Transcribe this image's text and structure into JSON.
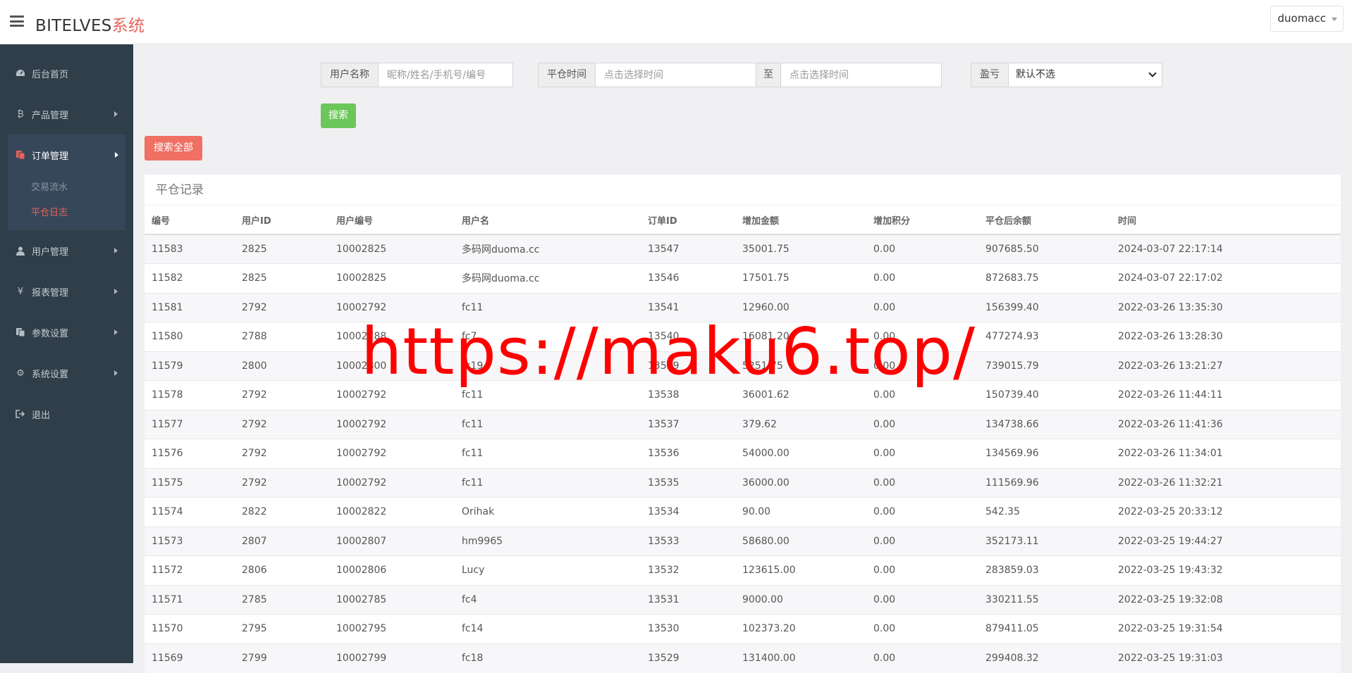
{
  "header": {
    "brand_main": "BITELVES",
    "brand_accent": "系统",
    "user": "duomacc"
  },
  "sidebar": {
    "items": [
      {
        "label": "后台首页",
        "icon": "dashboard-icon"
      },
      {
        "label": "产品管理",
        "icon": "bitcoin-icon"
      },
      {
        "label": "订单管理",
        "icon": "copy-icon"
      },
      {
        "label": "用户管理",
        "icon": "user-icon"
      },
      {
        "label": "报表管理",
        "icon": "yen-icon"
      },
      {
        "label": "参数设置",
        "icon": "copy-icon"
      },
      {
        "label": "系统设置",
        "icon": "gears-icon"
      },
      {
        "label": "退出",
        "icon": "sign-out-icon"
      }
    ],
    "sub_items": [
      {
        "label": "交易流水"
      },
      {
        "label": "平仓日志"
      }
    ]
  },
  "filters": {
    "username_label": "用户名称",
    "username_placeholder": "昵称/姓名/手机号/编号",
    "time_label": "平仓时间",
    "time_start_placeholder": "点击选择时间",
    "time_sep": "至",
    "time_end_placeholder": "点击选择时间",
    "pnl_label": "盈亏",
    "pnl_selected": "默认不选",
    "search_button": "搜索",
    "search_all_button": "搜索全部"
  },
  "table": {
    "title": "平仓记录",
    "columns": [
      "编号",
      "用户ID",
      "用户编号",
      "用户名",
      "订单ID",
      "增加金额",
      "增加积分",
      "平仓后余额",
      "时间"
    ],
    "rows": [
      [
        "11583",
        "2825",
        "10002825",
        "多码网duoma.cc",
        "13547",
        "35001.75",
        "0.00",
        "907685.50",
        "2024-03-07 22:17:14"
      ],
      [
        "11582",
        "2825",
        "10002825",
        "多码网duoma.cc",
        "13546",
        "17501.75",
        "0.00",
        "872683.75",
        "2024-03-07 22:17:02"
      ],
      [
        "11581",
        "2792",
        "10002792",
        "fc11",
        "13541",
        "12960.00",
        "0.00",
        "156399.40",
        "2022-03-26 13:35:30"
      ],
      [
        "11580",
        "2788",
        "10002788",
        "fc7",
        "13540",
        "16081.20",
        "0.00",
        "477274.93",
        "2022-03-26 13:28:30"
      ],
      [
        "11579",
        "2800",
        "10002800",
        "fc19",
        "13539",
        "5251.75",
        "0.00",
        "739015.79",
        "2022-03-26 13:21:27"
      ],
      [
        "11578",
        "2792",
        "10002792",
        "fc11",
        "13538",
        "36001.62",
        "0.00",
        "150739.40",
        "2022-03-26 11:44:11"
      ],
      [
        "11577",
        "2792",
        "10002792",
        "fc11",
        "13537",
        "379.62",
        "0.00",
        "134738.66",
        "2022-03-26 11:41:36"
      ],
      [
        "11576",
        "2792",
        "10002792",
        "fc11",
        "13536",
        "54000.00",
        "0.00",
        "134569.96",
        "2022-03-26 11:34:01"
      ],
      [
        "11575",
        "2792",
        "10002792",
        "fc11",
        "13535",
        "36000.00",
        "0.00",
        "111569.96",
        "2022-03-26 11:32:21"
      ],
      [
        "11574",
        "2822",
        "10002822",
        "Orihak",
        "13534",
        "90.00",
        "0.00",
        "542.35",
        "2022-03-25 20:33:12"
      ],
      [
        "11573",
        "2807",
        "10002807",
        "hm9965",
        "13533",
        "58680.00",
        "0.00",
        "352173.11",
        "2022-03-25 19:44:27"
      ],
      [
        "11572",
        "2806",
        "10002806",
        "Lucy",
        "13532",
        "123615.00",
        "0.00",
        "283859.03",
        "2022-03-25 19:43:32"
      ],
      [
        "11571",
        "2785",
        "10002785",
        "fc4",
        "13531",
        "9000.00",
        "0.00",
        "330211.55",
        "2022-03-25 19:32:08"
      ],
      [
        "11570",
        "2795",
        "10002795",
        "fc14",
        "13530",
        "102373.20",
        "0.00",
        "879411.05",
        "2022-03-25 19:31:54"
      ],
      [
        "11569",
        "2799",
        "10002799",
        "fc18",
        "13529",
        "131400.00",
        "0.00",
        "299408.32",
        "2022-03-25 19:31:03"
      ]
    ]
  },
  "watermark": "https://maku6.top/"
}
